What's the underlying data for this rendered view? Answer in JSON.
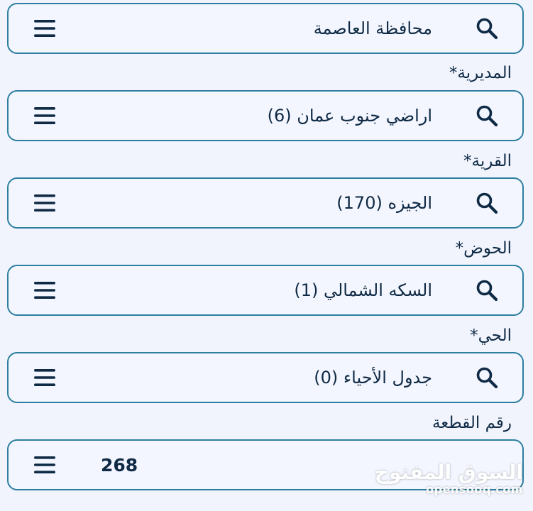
{
  "icons": {
    "menu": "hamburger-menu-icon",
    "search": "magnifier-search-icon"
  },
  "colors": {
    "border": "#2d7f9f",
    "text": "#0f2a45",
    "background": "#f1f4fd"
  },
  "fields": {
    "governorate": {
      "value": "محافظة العاصمة"
    },
    "directorate": {
      "label": "المديرية*",
      "value": "اراضي جنوب عمان (6)"
    },
    "village": {
      "label": "القرية*",
      "value": "الجيزه (170)"
    },
    "basin": {
      "label": "الحوض*",
      "value": "السكه الشمالي (1)"
    },
    "neighborhood": {
      "label": "الحي*",
      "value": "جدول الأحياء (0)"
    },
    "plot_number": {
      "label": "رقم القطعة",
      "value": "268"
    }
  },
  "watermark": {
    "arabic": "السوق المفتوح",
    "latin": "opensooq.com"
  }
}
